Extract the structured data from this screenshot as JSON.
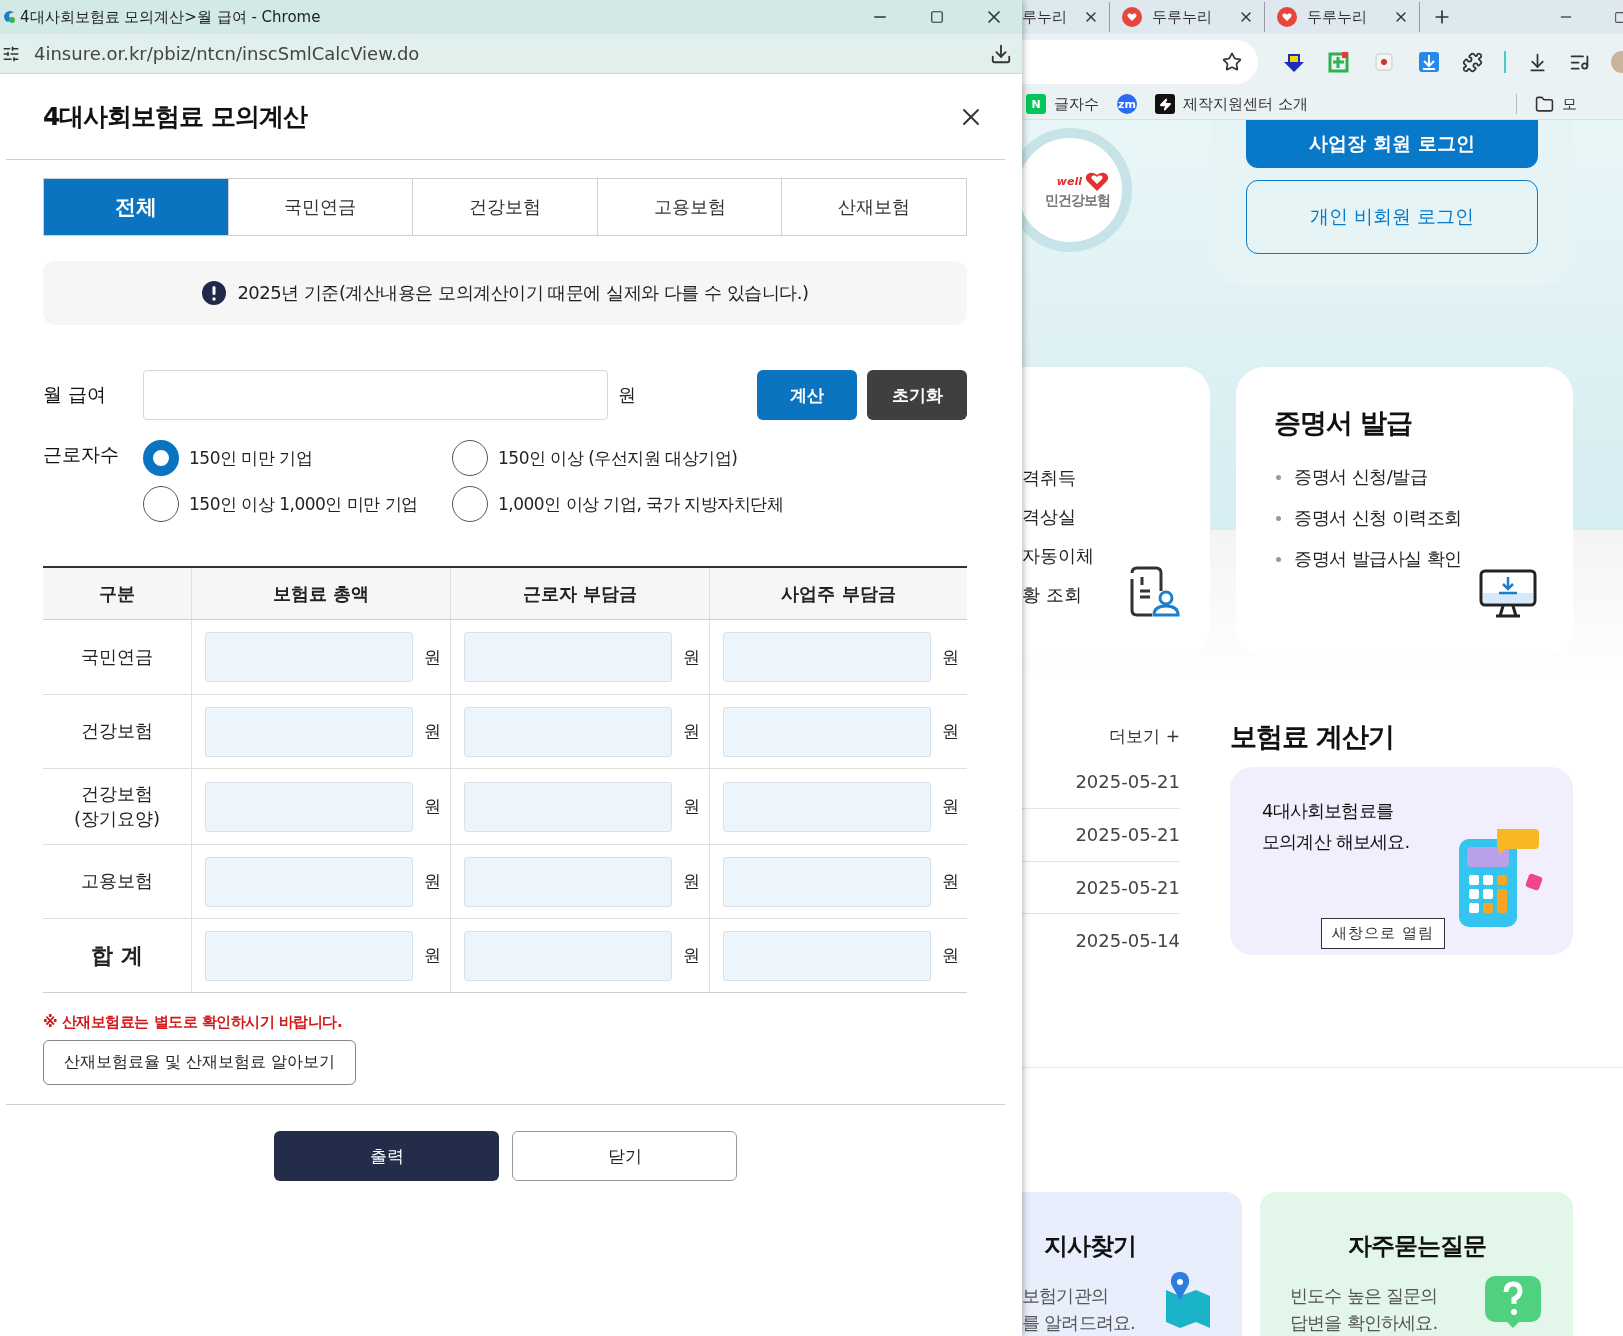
{
  "popup": {
    "window_title": "4대사회보험료 모의계산>월 급여 - Chrome",
    "url": "4insure.or.kr/pbiz/ntcn/inscSmlCalcView.do",
    "heading": "4대사회보험료 모의계산",
    "tabs": [
      {
        "label": "전체",
        "selected": true
      },
      {
        "label": "국민연금",
        "selected": false
      },
      {
        "label": "건강보험",
        "selected": false
      },
      {
        "label": "고용보험",
        "selected": false
      },
      {
        "label": "산재보험",
        "selected": false
      }
    ],
    "notice": "2025년 기준(계산내용은 모의계산이기 때문에 실제와 다를 수 있습니다.)",
    "salary": {
      "label": "월 급여",
      "unit": "원"
    },
    "actions": [
      {
        "label": "계산",
        "kind": "primary"
      },
      {
        "label": "초기화",
        "kind": "dark"
      }
    ],
    "workers": {
      "label": "근로자수",
      "options": [
        {
          "label": "150인 미만 기업",
          "selected": true
        },
        {
          "label": "150인 이상 (우선지원 대상기업)",
          "selected": false
        },
        {
          "label": "150인 이상 1,000인 미만 기업",
          "selected": false
        },
        {
          "label": "1,000인 이상 기업, 국가 지방자치단체",
          "selected": false
        }
      ]
    },
    "table": {
      "columns": [
        "구분",
        "보험료 총액",
        "근로자 부담금",
        "사업주 부담금"
      ],
      "rows": [
        {
          "label": [
            "국민연금"
          ],
          "kind": "normal",
          "units": [
            "원",
            "원",
            "원"
          ]
        },
        {
          "label": [
            "건강보험"
          ],
          "kind": "normal",
          "units": [
            "원",
            "원",
            "원"
          ]
        },
        {
          "label": [
            "건강보험",
            "(장기요양)"
          ],
          "kind": "normal",
          "units": [
            "원",
            "원",
            "원"
          ]
        },
        {
          "label": [
            "고용보험"
          ],
          "kind": "normal",
          "units": [
            "원",
            "원",
            "원"
          ]
        },
        {
          "label": [
            "합 계"
          ],
          "kind": "total",
          "units": [
            "원",
            "원",
            "원"
          ]
        }
      ]
    },
    "warning": "※ 산재보험료는 별도로 확인하시기 바랍니다.",
    "info_button": "산재보험료율 및 산재보험료 알아보기",
    "footer_buttons": [
      {
        "label": "출력",
        "kind": "primary"
      },
      {
        "label": "닫기",
        "kind": "secondary"
      }
    ]
  },
  "browser": {
    "tabs": [
      {
        "label": "루누리",
        "kind": "cut"
      },
      {
        "label": "두루누리",
        "kind": "full"
      },
      {
        "label": "두루누리",
        "kind": "full"
      }
    ],
    "bookmarks": [
      {
        "label": "글자수",
        "kind": "naver",
        "icon_text": "N"
      },
      {
        "kind": "zoom",
        "icon_text": "zm"
      },
      {
        "label": "제작지원센터 소개",
        "kind": "bolt"
      }
    ],
    "bookmarks_folder": "모",
    "page": {
      "logo": {
        "tagline": "well",
        "name": "민건강보험"
      },
      "login_buttons": [
        {
          "label": "사업장 회원 로그인",
          "kind": "filled"
        },
        {
          "label": "개인 비회원 로그인",
          "kind": "outline"
        }
      ],
      "services_items": [
        "격취득",
        "격상실",
        "자동이체",
        "황 조회"
      ],
      "certificate": {
        "title": "증명서 발급",
        "items": [
          "증명서 신청/발급",
          "증명서 신청 이력조회",
          "증명서 발급사실 확인"
        ]
      },
      "more": "더보기 +",
      "dates": [
        "2025-05-21",
        "2025-05-21",
        "2025-05-21",
        "2025-05-14"
      ],
      "calculator": {
        "title": "보험료 계산기",
        "text": [
          "4대사회보험료를",
          "모의계산 해보세요."
        ],
        "button": "새창으로 열림"
      },
      "branch": {
        "title": "지사찾기",
        "text": [
          "보험기관의",
          "를 알려드려요."
        ]
      },
      "faq": {
        "title": "자주묻는질문",
        "text": [
          "빈도수 높은 질문의",
          "답변을 확인하세요."
        ]
      }
    }
  }
}
